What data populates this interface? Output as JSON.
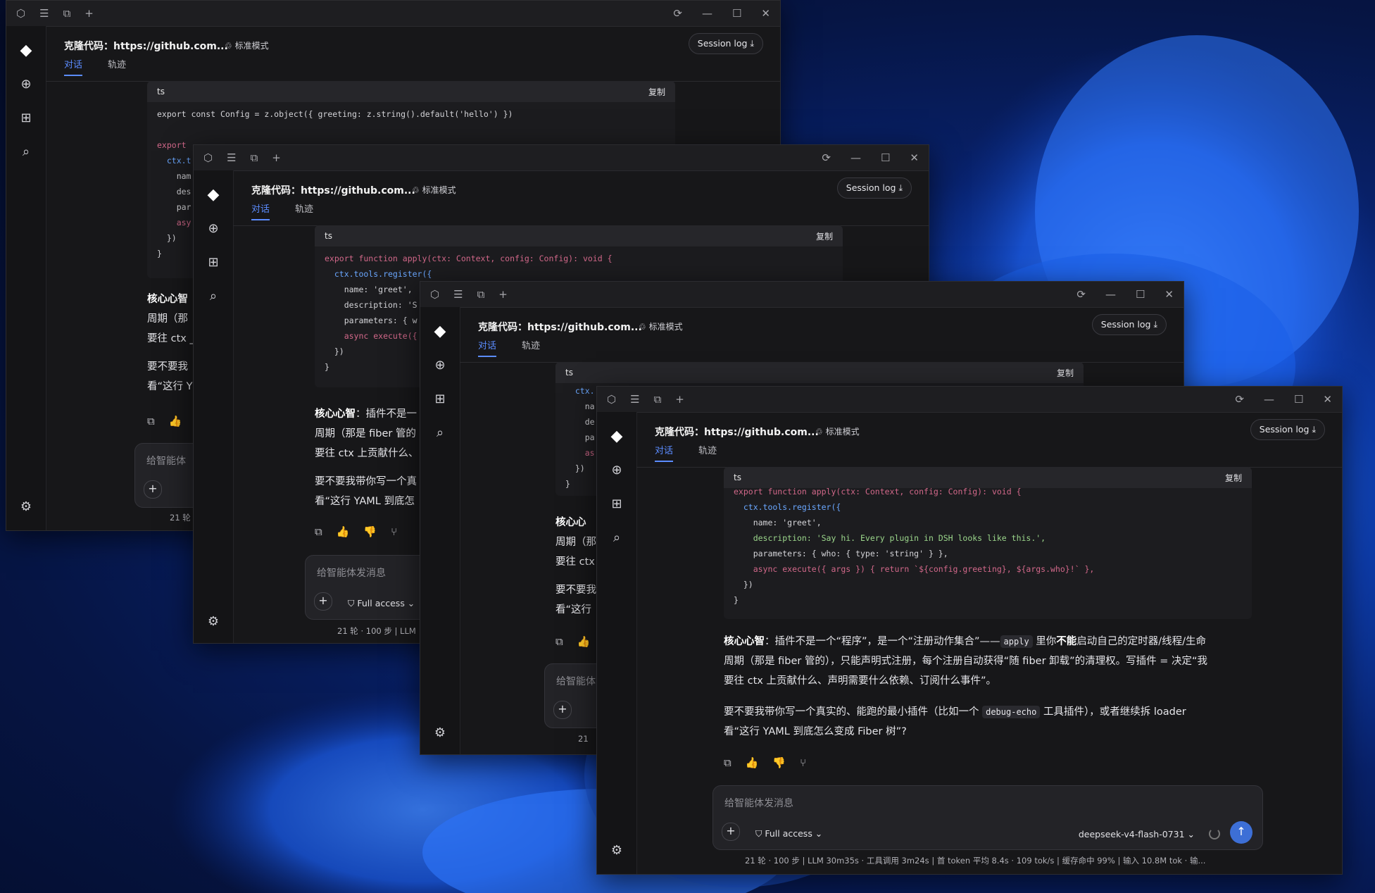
{
  "window": {
    "title": "克隆代码：https://github.com...",
    "mode": "标准模式",
    "session_log": "Session log",
    "tabs": [
      "对话",
      "轨迹"
    ]
  },
  "code": {
    "lang": "ts",
    "copy": "复制",
    "w1": {
      "line1": "export const Config = z.object({ greeting: z.string().default('hello') })",
      "line2": "export",
      "line3": "  ctx.t",
      "line4": "    nam",
      "line5": "    des",
      "line6": "    par",
      "line7": "    asy",
      "line8": "  })",
      "line9": "}"
    },
    "w2": {
      "line1": "export function apply(ctx: Context, config: Config): void {",
      "line2": "  ctx.tools.register({",
      "line3": "    name: 'greet',",
      "line4": "    description: 'S",
      "line5": "    parameters: { w",
      "line6": "    async execute({",
      "line7": "  })",
      "line8": "}"
    },
    "w3": {
      "line1": "  ctx.",
      "line2": "    na",
      "line3": "    de",
      "line4": "    pa",
      "line5": "    as",
      "line6": "  })",
      "line7": "}"
    },
    "w4": {
      "line1": "export function apply(ctx: Context, config: Config): void {",
      "line2": "  ctx.tools.register({",
      "line3": "    name: 'greet',",
      "line4": "    description: 'Say hi. Every plugin in DSH looks like this.',",
      "line5": "    parameters: { who: { type: 'string' } },",
      "line6": "    async execute({ args }) { return `${config.greeting}, ${args.who}!` },",
      "line7": "  })",
      "line8": "}"
    }
  },
  "message": {
    "p1_bold": "核心心智",
    "p1_a": "：插件不是一个“程序”，是一个“注册动作集合”——",
    "p1_code": "apply",
    "p1_b": " 里你",
    "p1_bold2": "不能",
    "p1_c": "启动自己的定时器/线程/生命",
    "p1_line2": "周期（那是 fiber 管的），只能声明式注册，每个注册自动获得“随 fiber 卸载”的清理权。写插件 = 决定“我",
    "p1_line3": "要往 ctx 上贡献什么、声明需要什么依赖、订阅什么事件”。",
    "p2_a": "要不要我带你写一个真实的、能跑的最小插件（比如一个 ",
    "p2_code": "debug-echo",
    "p2_b": " 工具插件），或者继续拆 loader",
    "p2_line2": "看“这行 YAML 到底怎么变成 Fiber 树”?",
    "trunc": {
      "w1_l1": "核心心智",
      "w1_l2": "周期（那",
      "w1_l3": "要往 ctx _",
      "w1_l4": "要不要我",
      "w1_l5": "看“这行 Y",
      "w2_l1a": "核心心智",
      "w2_l1b": "：插件不是一",
      "w2_l2": "周期（那是 fiber 管的",
      "w2_l3": "要往 ctx 上贡献什么、",
      "w2_l4": "要不要我带你写一个真",
      "w2_l5": "看“这行 YAML 到底怎",
      "w3_l1": "核心心",
      "w3_l2": "周期（那",
      "w3_l3": "要往 ctx",
      "w3_l4": "要不要我",
      "w3_l5": "看“这行"
    }
  },
  "composer": {
    "placeholder": "给智能体发消息",
    "placeholder_short": "给智能体",
    "placeholder_short3": "给智能体",
    "access": "Full access",
    "model": "deepseek-v4-flash-0731"
  },
  "status": {
    "full": "21 轮 · 100 步   |   LLM 30m35s · 工具调用 3m24s   |   首 token 平均 8.4s · 109 tok/s   |   缓存命中 99%   |   输入 10.8M tok · 输...",
    "w1": "21 轮",
    "w2": "21 轮 · 100 步   |   LLM",
    "w3": "21"
  },
  "icons": {
    "titlebar_left": [
      "cube-icon",
      "sliders-icon",
      "share-icon",
      "plus-icon"
    ],
    "titlebar_right": [
      "refresh-icon",
      "minimize-icon",
      "maximize-icon",
      "close-icon"
    ],
    "rail": [
      "whale-logo-icon",
      "new-chat-icon",
      "add-project-icon",
      "search-icon",
      "settings-icon"
    ]
  }
}
